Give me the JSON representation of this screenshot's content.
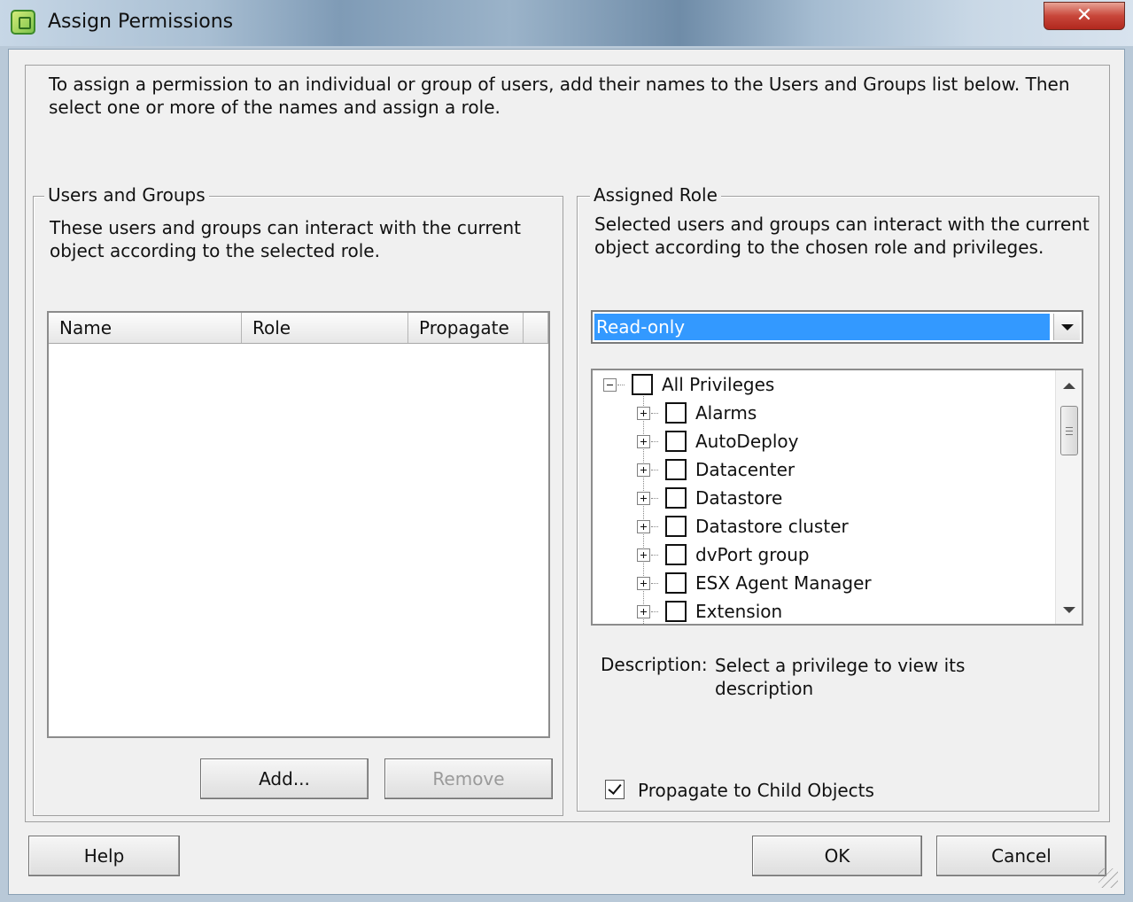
{
  "window": {
    "title": "Assign Permissions",
    "close_glyph": "✕"
  },
  "intro": "To assign a permission to an individual or group of users, add their names to the Users and Groups list below. Then select one or more of the names and assign a role.",
  "users_groups": {
    "legend": "Users and Groups",
    "description": "These users and groups can interact with the current object according to the selected role.",
    "columns": [
      "Name",
      "Role",
      "Propagate"
    ],
    "rows": [],
    "add_label": "Add...",
    "remove_label": "Remove"
  },
  "assigned_role": {
    "legend": "Assigned Role",
    "description": "Selected users and groups can interact with the current object according to the chosen role and privileges.",
    "selected_role": "Read-only",
    "privileges_root": "All Privileges",
    "privileges": [
      "Alarms",
      "AutoDeploy",
      "Datacenter",
      "Datastore",
      "Datastore cluster",
      "dvPort group",
      "ESX Agent Manager",
      "Extension"
    ],
    "description_label": "Description:",
    "description_text": "Select a privilege to view its description",
    "propagate_label": "Propagate to Child Objects",
    "propagate_checked": true
  },
  "footer": {
    "help_label": "Help",
    "ok_label": "OK",
    "cancel_label": "Cancel"
  },
  "colors": {
    "selection": "#3399ff",
    "dialog_bg": "#f0f0f0",
    "close_red": "#c8463a"
  }
}
